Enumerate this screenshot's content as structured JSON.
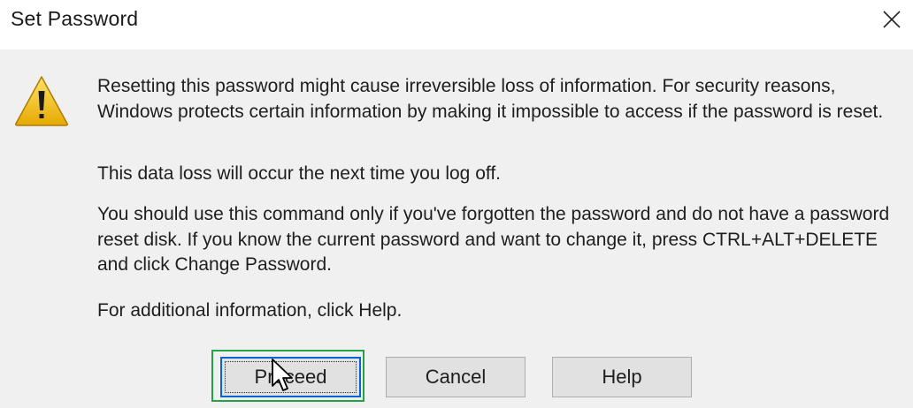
{
  "window": {
    "title": "Set Password",
    "close_icon": "close-icon"
  },
  "icon": "warning-icon",
  "message": {
    "p1": "Resetting this password might cause irreversible loss of information. For security reasons, Windows protects certain information by making it impossible to access if the password is reset.",
    "p2": "This data loss will occur the next time you log off.",
    "p3": "You should use this command only if you've forgotten the password and do not have a password reset disk. If you know the current password and want to change it, press CTRL+ALT+DELETE and click Change Password.",
    "p4": "For additional information, click Help."
  },
  "buttons": {
    "proceed": "Proceed",
    "cancel": "Cancel",
    "help": "Help"
  },
  "colors": {
    "highlight": "#21a346",
    "focus_border": "#0a64d2",
    "warning_yellow": "#f2c40f"
  }
}
